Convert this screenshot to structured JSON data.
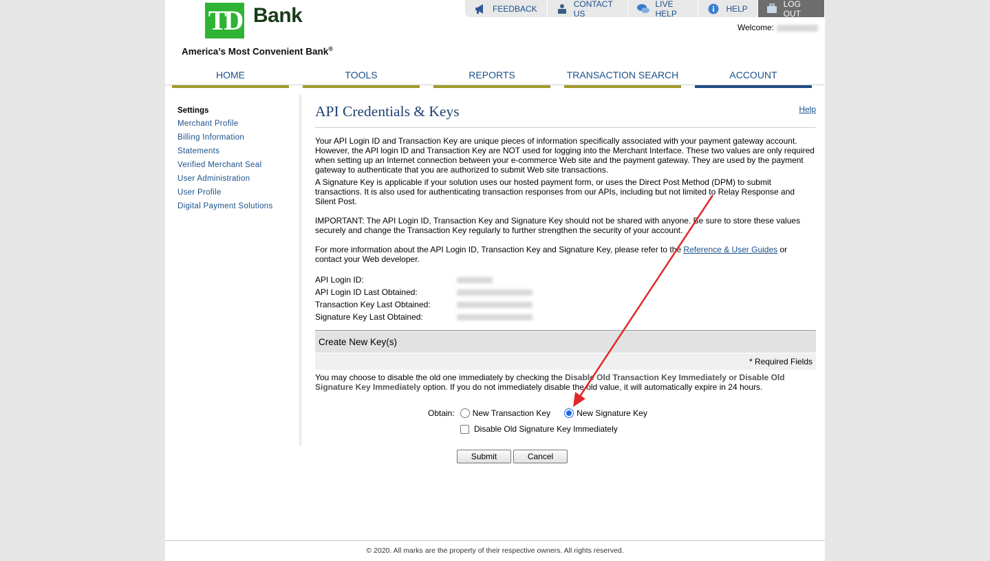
{
  "header": {
    "logo_text": "TD",
    "bank_name": "Bank",
    "tagline": "America’s Most Convenient Bank",
    "tagline_mark": "®",
    "welcome_label": "Welcome:"
  },
  "top_links": [
    {
      "label": "FEEDBACK",
      "icon": "megaphone-icon"
    },
    {
      "label": "CONTACT US",
      "icon": "person-desk-icon"
    },
    {
      "label": "LIVE HELP",
      "icon": "chat-bubbles-icon"
    },
    {
      "label": "HELP",
      "icon": "info-icon"
    },
    {
      "label": "LOG OUT",
      "icon": "briefcase-icon"
    }
  ],
  "nav": {
    "items": [
      "HOME",
      "TOOLS",
      "REPORTS",
      "TRANSACTION SEARCH",
      "ACCOUNT"
    ],
    "active": "ACCOUNT"
  },
  "sidebar": {
    "title": "Settings",
    "items": [
      "Merchant Profile",
      "Billing Information",
      "Statements",
      "Verified Merchant Seal",
      "User Administration",
      "User Profile",
      "Digital Payment Solutions"
    ]
  },
  "main": {
    "title": "API Credentials & Keys",
    "help_link": "Help",
    "para1": "Your API Login ID and Transaction Key are unique pieces of information specifically associated with your payment gateway account. However, the API login ID and Transaction Key are NOT used for logging into the Merchant Interface. These two values are only required when setting up an Internet connection between your e-commerce Web site and the payment gateway. They are used by the payment gateway to authenticate that you are authorized to submit Web site transactions.",
    "para2": "A Signature Key is applicable if your solution uses our hosted payment form, or uses the Direct Post Method (DPM) to submit transactions. It is also used for authenticating transaction responses from our APIs, including but not limited to Relay Response and Silent Post.",
    "para3": "IMPORTANT: The API Login ID, Transaction Key and Signature Key should not be shared with anyone. Be sure to store these values securely and change the Transaction Key regularly to further strengthen the security of your account.",
    "para4_before": "For more information about the API Login ID, Transaction Key and Signature Key, please refer to the ",
    "para4_link": "Reference & User Guides",
    "para4_after": " or contact your Web developer.",
    "info_labels": [
      "API Login ID:",
      "API Login ID Last Obtained:",
      "Transaction Key Last Obtained:",
      "Signature Key Last Obtained:"
    ],
    "create_title": "Create New Key(s)",
    "required_fields": "* Required Fields",
    "note_before": "You may choose to disable the old one immediately by checking the ",
    "note_bold": "Disable Old Transaction Key Immediately or Disable Old Signature Key Immediately",
    "note_after": " option. If you do not immediately disable the old value, it will automatically expire in 24 hours.",
    "obtain_label": "Obtain:",
    "option_transaction": "New Transaction Key",
    "option_signature": "New Signature Key",
    "selected_option": "New Signature Key",
    "disable_checkbox_label": "Disable Old Signature Key Immediately",
    "disable_checked": false,
    "submit_label": "Submit",
    "cancel_label": "Cancel"
  },
  "footer": {
    "text": "© 2020. All marks are the property of their respective owners. All rights reserved."
  },
  "colors": {
    "brand_green": "#2fb334",
    "nav_text": "#1a4f8a",
    "nav_underline": "#a09a2a",
    "nav_active_underline": "#1f4c84",
    "annotation_arrow": "#e0282a"
  }
}
